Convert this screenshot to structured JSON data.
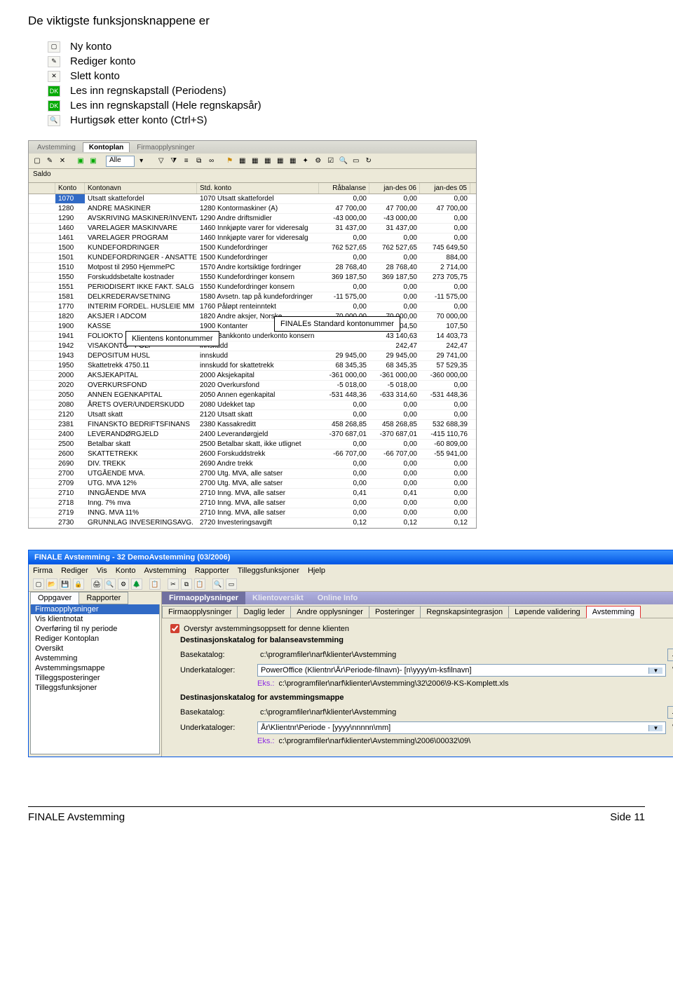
{
  "heading": "De viktigste funksjonsknappene er",
  "functions": [
    {
      "icon": "new",
      "label": "Ny konto"
    },
    {
      "icon": "edit",
      "label": "Rediger konto"
    },
    {
      "icon": "del",
      "label": "Slett konto"
    },
    {
      "icon": "dk",
      "label": "Les inn regnskapstall (Periodens)"
    },
    {
      "icon": "dk12",
      "label": "Les inn regnskapstall (Hele regnskapsår)"
    },
    {
      "icon": "find",
      "label": "Hurtigsøk etter konto (Ctrl+S)"
    }
  ],
  "ss1": {
    "tabs": [
      "Avstemming",
      "Kontoplan",
      "Firmaopplysninger"
    ],
    "active_tab": 1,
    "filter_label": "Alle",
    "saldo_label": "Saldo",
    "headers": [
      "",
      "Konto",
      "Kontonavn",
      "Std. konto",
      "Råbalanse",
      "jan-des 06",
      "jan-des 05"
    ],
    "rows": [
      [
        "",
        "1070",
        "Utsatt skattefordel",
        "1070 Utsatt skattefordel",
        "0,00",
        "0,00",
        "0,00"
      ],
      [
        "",
        "1280",
        "ANDRE MASKINER",
        "1280 Kontormaskiner (A)",
        "47 700,00",
        "47 700,00",
        "47 700,00"
      ],
      [
        "",
        "1290",
        "AVSKRIVING MASKINER/INVENTAR",
        "1290 Andre driftsmidler",
        "-43 000,00",
        "-43 000,00",
        "0,00"
      ],
      [
        "",
        "1460",
        "VARELAGER MASKINVARE",
        "1460 Innkjøpte varer for videresalg",
        "31 437,00",
        "31 437,00",
        "0,00"
      ],
      [
        "",
        "1461",
        "VARELAGER PROGRAM",
        "1460 Innkjøpte varer for videresalg",
        "0,00",
        "0,00",
        "0,00"
      ],
      [
        "",
        "1500",
        "KUNDEFORDRINGER",
        "1500 Kundefordringer",
        "762 527,65",
        "762 527,65",
        "745 649,50"
      ],
      [
        "",
        "1501",
        "KUNDEFORDRINGER - ANSATTE",
        "1500 Kundefordringer",
        "0,00",
        "0,00",
        "884,00"
      ],
      [
        "",
        "1510",
        "Motpost til 2950 HjemmePC",
        "1570 Andre kortsiktige fordringer",
        "28 768,40",
        "28 768,40",
        "2 714,00"
      ],
      [
        "",
        "1550",
        "Forskuddsbetalte kostnader",
        "1550 Kundefordringer konsern",
        "369 187,50",
        "369 187,50",
        "273 705,75"
      ],
      [
        "",
        "1551",
        "PERIODISERT IKKE FAKT. SALG",
        "1550 Kundefordringer konsern",
        "0,00",
        "0,00",
        "0,00"
      ],
      [
        "",
        "1581",
        "DELKREDERAVSETNING",
        "1580 Avsetn. tap på kundefordringer",
        "-11 575,00",
        "0,00",
        "-11 575,00"
      ],
      [
        "",
        "1770",
        "INTERIM FORDEL. HUSLEIE MM",
        "1760 Påløpt renteinntekt",
        "0,00",
        "0,00",
        "0,00"
      ],
      [
        "",
        "1820",
        "AKSJER I ADCOM",
        "1820 Andre aksjer, Norske",
        "70 000,00",
        "70 000,00",
        "70 000,00"
      ],
      [
        "",
        "1900",
        "KASSE",
        "1900 Kontanter",
        "",
        "404,50",
        "107,50"
      ],
      [
        "",
        "1941",
        "FOLIOKTO SPAREBANK 1/ADCOM",
        "1565 Bankkonto underkonto konsern",
        "",
        "43 140,63",
        "14 403,73"
      ],
      [
        "",
        "1942",
        "VISAKONTO - FOLI",
        "innskudd",
        "",
        "242,47",
        "242,47"
      ],
      [
        "",
        "1943",
        "DEPOSITUM HUSL",
        "innskudd",
        "29 945,00",
        "29 945,00",
        "29 741,00"
      ],
      [
        "",
        "1950",
        "Skattetrekk 4750.11",
        "innskudd for skattetrekk",
        "68 345,35",
        "68 345,35",
        "57 529,35"
      ],
      [
        "",
        "2000",
        "AKSJEKAPITAL",
        "2000 Aksjekapital",
        "-361 000,00",
        "-361 000,00",
        "-360 000,00"
      ],
      [
        "",
        "2020",
        "OVERKURSFOND",
        "2020 Overkursfond",
        "-5 018,00",
        "-5 018,00",
        "0,00"
      ],
      [
        "",
        "2050",
        "ANNEN EGENKAPITAL",
        "2050 Annen egenkapital",
        "-531 448,36",
        "-633 314,60",
        "-531 448,36"
      ],
      [
        "",
        "2080",
        "ÅRETS OVER/UNDERSKUDD",
        "2080 Udekket tap",
        "0,00",
        "0,00",
        "0,00"
      ],
      [
        "",
        "2120",
        "Utsatt skatt",
        "2120 Utsatt skatt",
        "0,00",
        "0,00",
        "0,00"
      ],
      [
        "",
        "2381",
        "FINANSKTO BEDRIFTSFINANS",
        "2380 Kassakreditt",
        "458 268,85",
        "458 268,85",
        "532 688,39"
      ],
      [
        "",
        "2400",
        "LEVERANDØRGJELD",
        "2400 Leverandørgjeld",
        "-370 687,01",
        "-370 687,01",
        "-415 110,76"
      ],
      [
        "",
        "2500",
        "Betalbar skatt",
        "2500 Betalbar skatt, ikke utlignet",
        "0,00",
        "0,00",
        "-60 809,00"
      ],
      [
        "",
        "2600",
        "SKATTETREKK",
        "2600 Forskuddstrekk",
        "-66 707,00",
        "-66 707,00",
        "-55 941,00"
      ],
      [
        "",
        "2690",
        "DIV. TREKK",
        "2690 Andre trekk",
        "0,00",
        "0,00",
        "0,00"
      ],
      [
        "",
        "2700",
        "UTGÅENDE MVA.",
        "2700 Utg. MVA, alle satser",
        "0,00",
        "0,00",
        "0,00"
      ],
      [
        "",
        "2709",
        "UTG. MVA 12%",
        "2700 Utg. MVA, alle satser",
        "0,00",
        "0,00",
        "0,00"
      ],
      [
        "",
        "2710",
        "INNGÅENDE MVA",
        "2710 Inng. MVA, alle satser",
        "0,41",
        "0,41",
        "0,00"
      ],
      [
        "",
        "2718",
        "Inng. 7% mva",
        "2710 Inng. MVA, alle satser",
        "0,00",
        "0,00",
        "0,00"
      ],
      [
        "",
        "2719",
        "INNG. MVA 11%",
        "2710 Inng. MVA, alle satser",
        "0,00",
        "0,00",
        "0,00"
      ],
      [
        "",
        "2730",
        "GRUNNLAG INVESERINGSAVG.",
        "2720 Investeringsavgift",
        "0,12",
        "0,12",
        "0,12"
      ]
    ],
    "callout_klient": "Klientens kontonummer",
    "callout_finale": "FINALEs Standard kontonummer"
  },
  "ss2": {
    "title": "FINALE Avstemming - 32 DemoAvstemming (03/2006)",
    "menu": [
      "Firma",
      "Rediger",
      "Vis",
      "Konto",
      "Avstemming",
      "Rapporter",
      "Tilleggsfunksjoner",
      "Hjelp"
    ],
    "side_tabs": [
      "Oppgaver",
      "Rapporter"
    ],
    "side_items": [
      "Firmaopplysninger",
      "Vis klientnotat",
      "Overføring til ny periode",
      "Rediger Kontoplan",
      "Oversikt",
      "Avstemming",
      "Avstemmingsmappe",
      "Tilleggsposteringer",
      "Tilleggsfunksjoner"
    ],
    "content_tabs": [
      "Firmaopplysninger",
      "Klientoversikt",
      "Online Info"
    ],
    "sub_tabs": [
      "Firmaopplysninger",
      "Daglig leder",
      "Andre opplysninger",
      "Posteringer",
      "Regnskapsintegrasjon",
      "Løpende validering",
      "Avstemming"
    ],
    "overstyr": "Overstyr avstemmingsoppsett for denne klienten",
    "h1": "Destinasjonskatalog for balanseavstemming",
    "basekat_label": "Basekatalog:",
    "basekat1": "c:\\programfiler\\narf\\klienter\\Avstemming",
    "underkat_label": "Underkataloger:",
    "underkat1": "PowerOffice (Klientnr\\År\\Periode-filnavn)- [n\\yyyy\\m-ksfilnavn]",
    "eks_label": "Eks.:",
    "eks1": "c:\\programfiler\\narf\\klienter\\Avstemming\\32\\2006\\9-KS-Komplett.xls",
    "h2": "Destinasjonskatalog for avstemmingsmappe",
    "basekat2": "c:\\programfiler\\narf\\klienter\\Avstemming",
    "underkat2": "År\\Klientnr\\Periode - [yyyy\\nnnnn\\mm]",
    "eks2": "c:\\programfiler\\narf\\klienter\\Avstemming\\2006\\00032\\09\\"
  },
  "footer_left": "FINALE Avstemming",
  "footer_right": "Side 11"
}
